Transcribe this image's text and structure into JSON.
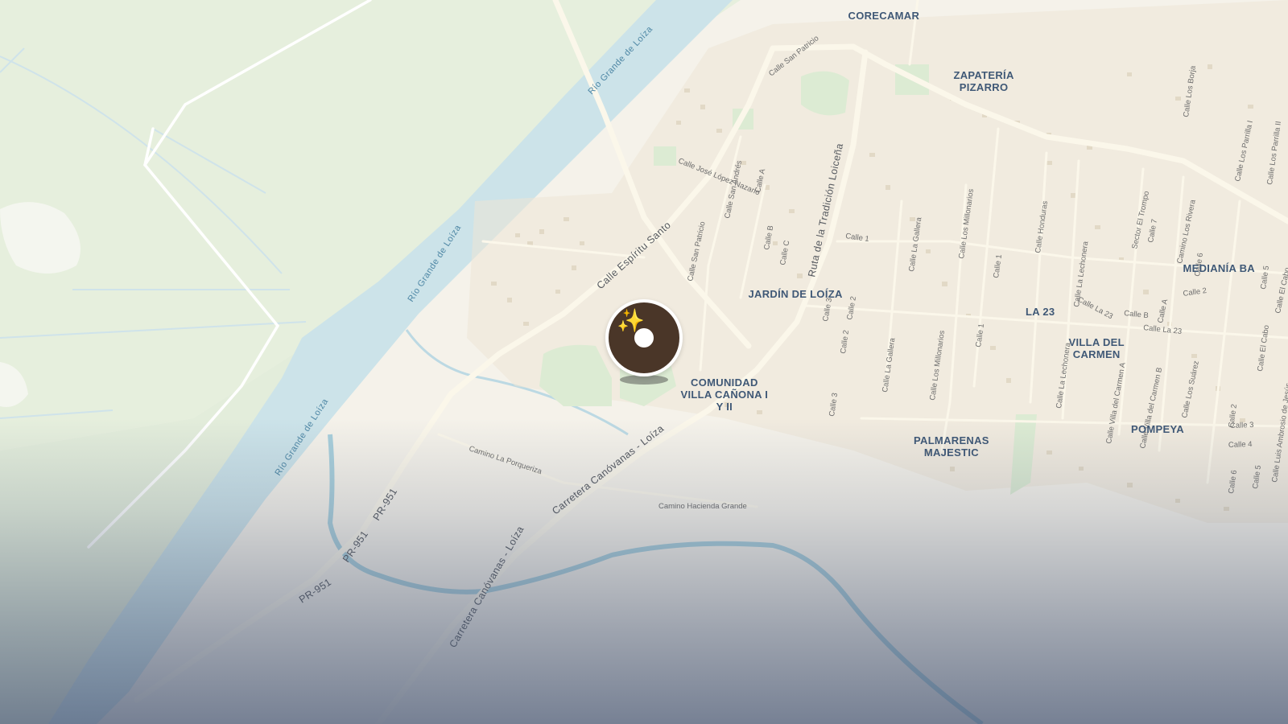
{
  "map": {
    "neighborhoods": [
      {
        "id": "corecamar",
        "lines": [
          "CORECAMAR"
        ]
      },
      {
        "id": "zapateria-pizarro",
        "lines": [
          "ZAPATERÍA",
          "PIZARRO"
        ]
      },
      {
        "id": "mediania-baja",
        "lines": [
          "MEDIANÍA BA"
        ]
      },
      {
        "id": "jardin-de-loiza",
        "lines": [
          "JARDÍN DE LOÍZA"
        ]
      },
      {
        "id": "la-23",
        "lines": [
          "LA 23"
        ]
      },
      {
        "id": "villa-del-carmen",
        "lines": [
          "VILLA DEL",
          "CARMEN"
        ]
      },
      {
        "id": "comunidad-villa-canona",
        "lines": [
          "COMUNIDAD",
          "VILLA CAÑONA I",
          "Y II"
        ]
      },
      {
        "id": "palmarenas-majestic",
        "lines": [
          "PALMARENAS",
          "MAJESTIC"
        ]
      },
      {
        "id": "pompeya",
        "lines": [
          "POMPEYA"
        ]
      }
    ],
    "roads": {
      "espiritu_santo": "Calle Espíritu Santo",
      "san_patricio_1": "Calle San Patricio",
      "san_patricio_2": "Calle San Patricio",
      "jose_lopez_nazario": "Calle José López Nazario",
      "san_andres": "Calle San Andrés",
      "calle_a": "Calle A",
      "calle_b": "Calle B",
      "calle_c": "Calle C",
      "ruta_tradicion": "Ruta de la Tradición Loiceña",
      "calle_1": "Calle 1",
      "calle_3": "Calle 3",
      "calle_2": "Calle 2",
      "la_gallera_1": "Calle La Gallera",
      "la_gallera_2": "Calle La Gallera",
      "los_millonarios_1": "Calle Los Millonarios",
      "los_millonarios_2": "Calle Los Millonarios",
      "calle_1b": "Calle 1",
      "calle_1c": "Calle 1",
      "honduras": "Calle Honduras",
      "la_lechonera_1": "Calle La Lechonera",
      "la_lechonera_2": "Calle La Lechonera",
      "la_23": "Calle La 23",
      "calle_b2": "Calle B",
      "la_23_b": "Calle La 23",
      "sector_el_trompo": "Sector El Trompo",
      "calle_7": "Calle 7",
      "camino_los_rivera": "Camino Los Rivera",
      "los_borja": "Calle Los Borja",
      "los_parrilla_1": "Calle Los Parrilla I",
      "los_parrilla_2": "Calle Los Parrilla II",
      "calle_6": "Calle 6",
      "calle_5": "Calle 5",
      "calle_2b": "Calle 2",
      "calle_ab": "Calle A",
      "el_cabo_1": "Calle El Cabo",
      "el_cabo_2": "Calle El Cabo",
      "villa_carmen_a": "Calle Villa del Carmen A",
      "villa_carmen_b": "Calle Villa del Carmen B",
      "los_suarez": "Calle Los Suárez",
      "calle_2c": "Calle 2",
      "calle_3b": "Calle 3",
      "calle_4": "Calle 4",
      "calle_6b": "Calle 6",
      "calle_5b": "Calle 5",
      "luis_ambrosio": "Calle Luis Ambrosio de Jesús",
      "calle_3c": "Calle 3",
      "calle_2d": "Calle 2",
      "camino_la_porqueriza": "Camino La Porqueriza",
      "camino_hacienda_grande": "Camino Hacienda Grande",
      "carretera_1": "Carretera Canóvanas - Loíza",
      "carretera_2": "Carretera Canóvanas - Loíza",
      "pr951_1": "PR-951",
      "pr951_2": "PR-951",
      "pr951_3": "PR-951"
    },
    "rivers": {
      "rio_1": "Río Grande de Loíza",
      "rio_2": "Río Grande de Loíza",
      "rio_3": "Río Grande de Loíza"
    },
    "marker": {
      "icon": "donut-icon",
      "accent": "#f4c430",
      "color": "#4a3628"
    }
  }
}
